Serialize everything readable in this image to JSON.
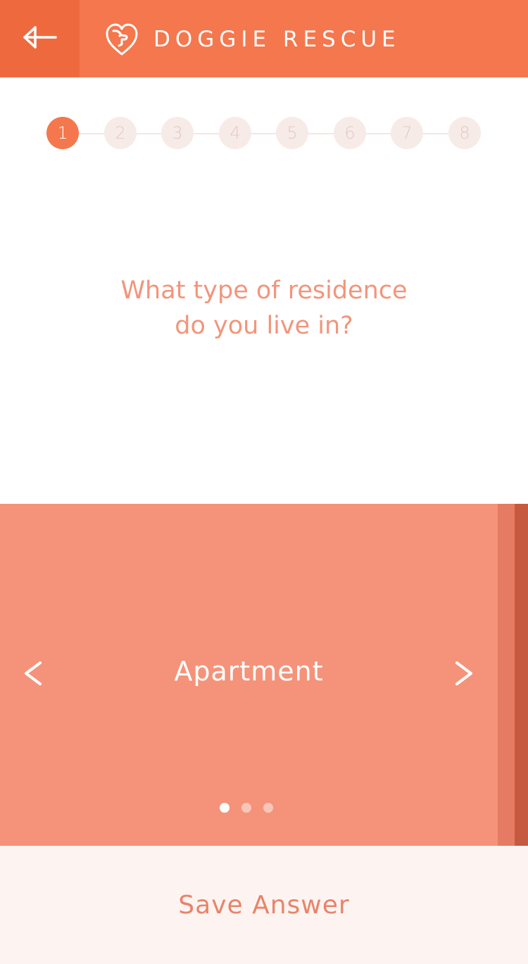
{
  "header": {
    "back_icon": "back-arrow-icon",
    "logo_icon": "dog-heart-logo-icon",
    "title": "DOGGIE RESCUE"
  },
  "stepper": {
    "steps": [
      "1",
      "2",
      "3",
      "4",
      "5",
      "6",
      "7",
      "8"
    ],
    "current": 1
  },
  "question": {
    "line1": "What type of residence",
    "line2": "do you live in?"
  },
  "carousel": {
    "current_option": "Apartment",
    "prev_icon": "chevron-left-icon",
    "next_icon": "chevron-right-icon",
    "pages": 3,
    "active_page": 1
  },
  "footer": {
    "save_label": "Save Answer"
  },
  "colors": {
    "accent": "#f4774e",
    "accent_dark": "#ee6a3e",
    "carousel_bg": "#f4937a",
    "question_text": "#f2957b",
    "footer_bg": "#fdf4f1",
    "footer_text": "#e9836a",
    "step_inactive_bg": "#f7ebe8",
    "step_inactive_text": "#e3c9c2"
  }
}
